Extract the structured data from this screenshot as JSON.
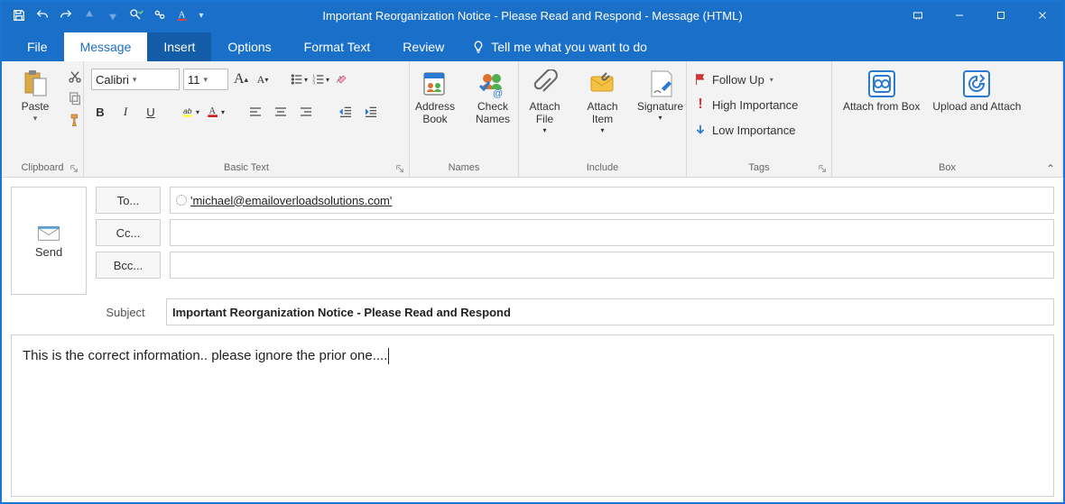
{
  "titlebar": {
    "title": "Important Reorganization Notice - Please Read and Respond  -  Message (HTML)"
  },
  "tabs": {
    "file": "File",
    "message": "Message",
    "insert": "Insert",
    "options": "Options",
    "format_text": "Format Text",
    "review": "Review",
    "tellme": "Tell me what you want to do"
  },
  "ribbon": {
    "clipboard": {
      "label": "Clipboard",
      "paste": "Paste"
    },
    "basic_text": {
      "label": "Basic Text",
      "font_name": "Calibri",
      "font_size": "11",
      "bold": "B",
      "italic": "I",
      "underline": "U"
    },
    "names": {
      "label": "Names",
      "address_book": "Address Book",
      "check_names": "Check Names"
    },
    "include": {
      "label": "Include",
      "attach_file": "Attach File",
      "attach_item": "Attach Item",
      "signature": "Signature"
    },
    "tags": {
      "label": "Tags",
      "follow_up": "Follow Up",
      "high": "High Importance",
      "low": "Low Importance"
    },
    "box": {
      "label": "Box",
      "attach_from_box": "Attach from Box",
      "upload_attach": "Upload and Attach"
    }
  },
  "message": {
    "send": "Send",
    "to_label": "To...",
    "cc_label": "Cc...",
    "bcc_label": "Bcc...",
    "subject_label": "Subject",
    "to_value": "'michael@emailoverloadsolutions.com'",
    "cc_value": "",
    "bcc_value": "",
    "subject_value": "Important Reorganization Notice - Please Read and Respond",
    "body": "This is the correct information.. please ignore the prior one...."
  }
}
